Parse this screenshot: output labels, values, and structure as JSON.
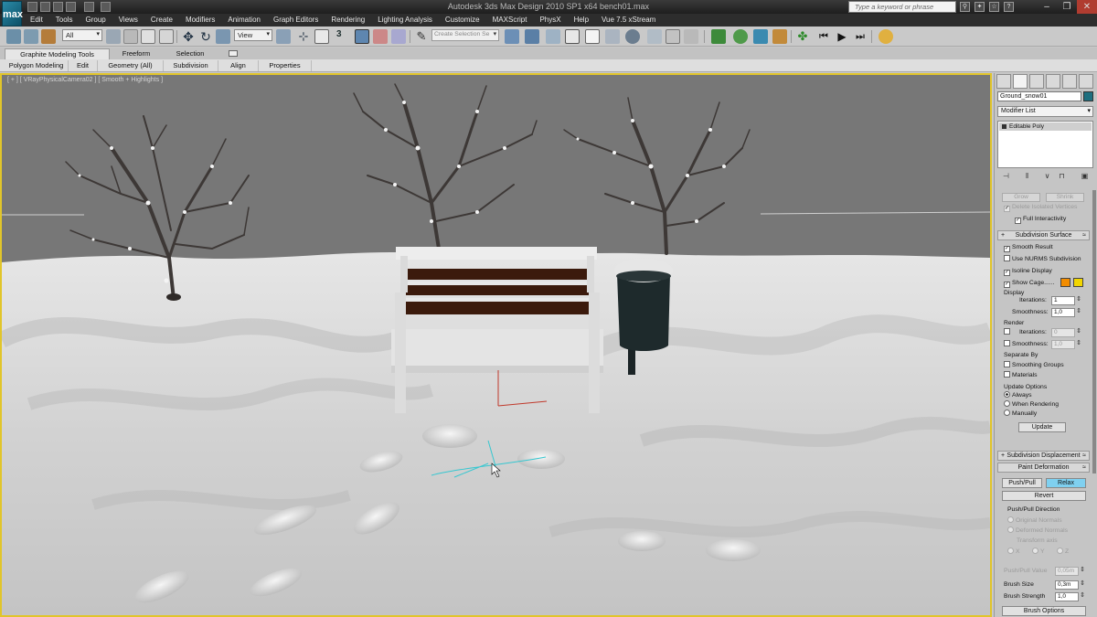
{
  "app": {
    "logo_text": "max",
    "title": "Autodesk 3ds Max Design 2010 SP1 x64      bench01.max",
    "search_placeholder": "Type a keyword or phrase"
  },
  "menu": [
    "Edit",
    "Tools",
    "Group",
    "Views",
    "Create",
    "Modifiers",
    "Animation",
    "Graph Editors",
    "Rendering",
    "Lighting Analysis",
    "Customize",
    "MAXScript",
    "PhysX",
    "Help",
    "Vue 7.5 xStream"
  ],
  "toolbar": {
    "selection_filter": "All",
    "ref_coord": "View",
    "create_selection_set": "Create Selection Se",
    "snap_label": "3"
  },
  "ribbon": {
    "tabs": [
      "Graphite Modeling Tools",
      "Freeform",
      "Selection"
    ],
    "active_tab": "Graphite Modeling Tools",
    "panels": [
      "Polygon Modeling",
      "Edit",
      "Geometry (All)",
      "Subdivision",
      "Align",
      "Properties"
    ]
  },
  "viewport": {
    "label": "[ + ] [ VRayPhysicalCamera02 ] [ Smooth + Highlights ]",
    "border_color": "#e1c52a"
  },
  "command_panel": {
    "object_name": "Ground_snow01",
    "object_color": "#1e6f7f",
    "modifier_list": "Modifier List",
    "stack": [
      "Editable Poly"
    ],
    "faded_buttons": [
      "Grow",
      "Shrink"
    ],
    "delete_isolated": "Delete Isolated Vertices",
    "full_interactivity": "Full Interactivity",
    "subdivision_surface": {
      "header": "Subdivision Surface",
      "smooth_result": "Smooth Result",
      "use_nurms": "Use NURMS Subdivision",
      "isoline_display": "Isoline Display",
      "show_cage": "Show Cage......",
      "cage_colors": [
        "#f28c00",
        "#f2d600"
      ],
      "display_label": "Display",
      "iterations_label": "Iterations:",
      "iterations_value": "1",
      "smoothness_label": "Smoothness:",
      "smoothness_value": "1,0",
      "render_label": "Render",
      "render_iterations_value": "0",
      "render_smoothness_value": "1,0",
      "separate_by": "Separate By",
      "smoothing_groups": "Smoothing Groups",
      "materials": "Materials",
      "update_options": "Update Options",
      "always": "Always",
      "when_rendering": "When Rendering",
      "manually": "Manually",
      "update_btn": "Update"
    },
    "subdivision_displacement": "Subdivision Displacement",
    "paint_deformation": {
      "header": "Paint Deformation",
      "push_pull": "Push/Pull",
      "relax": "Relax",
      "revert": "Revert",
      "direction_label": "Push/Pull Direction",
      "original_normals": "Original Normals",
      "deformed_normals": "Deformed Normals",
      "transform_axis": "Transform axis",
      "axes": [
        "X",
        "Y",
        "Z"
      ],
      "push_pull_value_label": "Push/Pull Value",
      "push_pull_value": "0,05m",
      "brush_size_label": "Brush Size",
      "brush_size": "0,3m",
      "brush_strength_label": "Brush Strength",
      "brush_strength": "1,0",
      "brush_options": "Brush Options"
    }
  }
}
